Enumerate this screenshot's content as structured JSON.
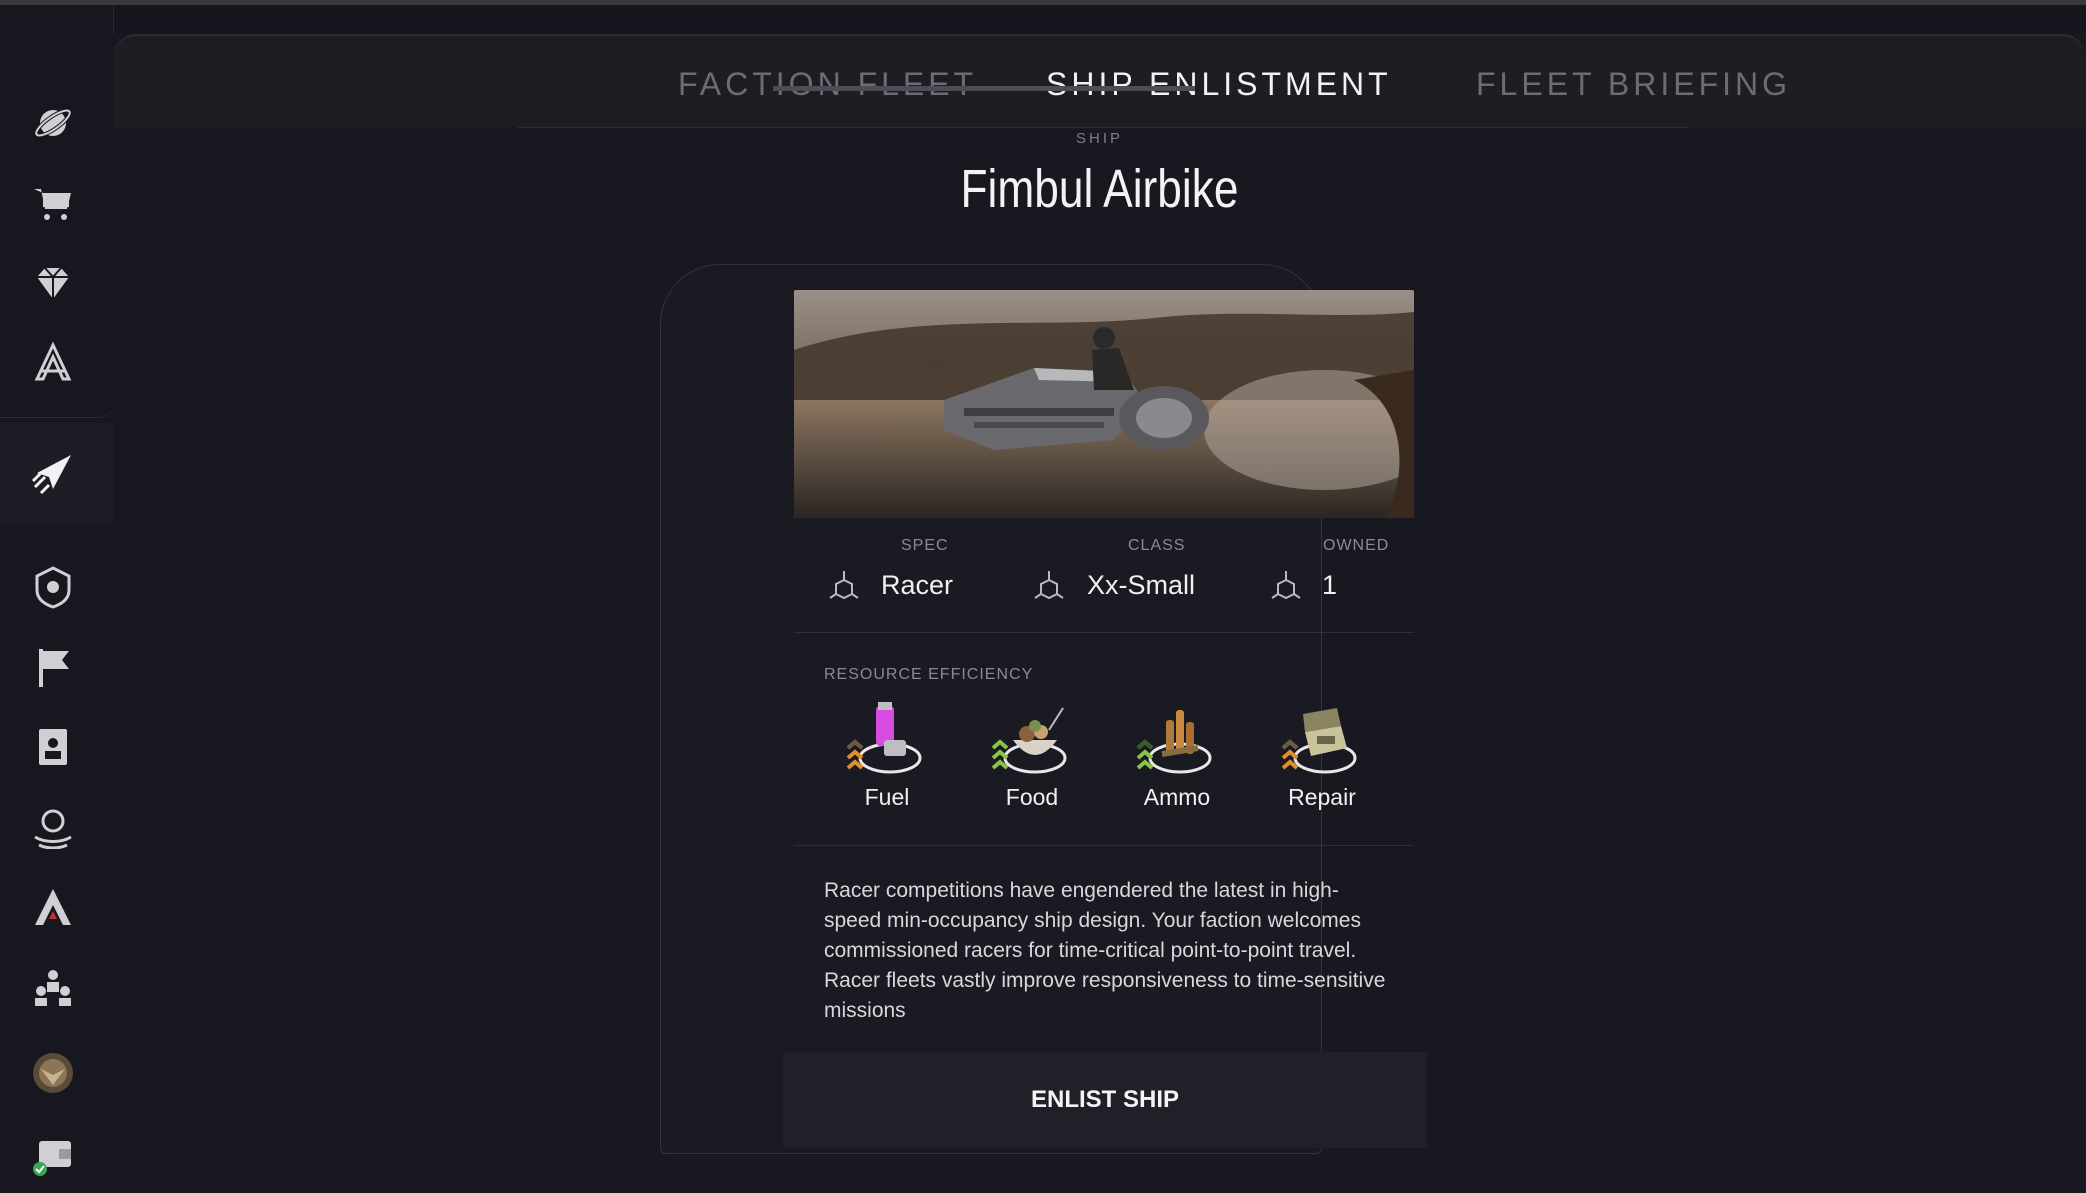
{
  "tabs": [
    {
      "label": "FACTION FLEET"
    },
    {
      "label": "SHIP ENLISTMENT"
    },
    {
      "label": "FLEET BRIEFING"
    }
  ],
  "active_tab": "SHIP ENLISTMENT",
  "ship": {
    "caption": "SHIP",
    "name": "Fimbul Airbike"
  },
  "stats": {
    "spec": {
      "label": "SPEC",
      "value": "Racer"
    },
    "class": {
      "label": "CLASS",
      "value": "Xx-Small"
    },
    "owned": {
      "label": "OWNED",
      "value": "1"
    }
  },
  "resources": {
    "title": "RESOURCE EFFICIENCY",
    "items": [
      {
        "label": "Fuel",
        "icon": "fuel-canister-icon"
      },
      {
        "label": "Food",
        "icon": "food-bowl-icon"
      },
      {
        "label": "Ammo",
        "icon": "ammo-rounds-icon"
      },
      {
        "label": "Repair",
        "icon": "repair-kit-icon"
      }
    ]
  },
  "description": "Racer competitions have engendered the latest in high-speed min-occupancy ship design. Your faction welcomes commissioned racers for time-critical point-to-point travel. Racer fleets vastly improve responsiveness to time-sensitive missions",
  "enlist_button": "ENLIST SHIP",
  "sidebar": {
    "icons": [
      "planet-icon",
      "cart-icon",
      "diamond-icon",
      "faction-emblem-icon",
      "fleet-ship-icon",
      "badge-icon",
      "flag-icon",
      "contract-icon",
      "guild-icon",
      "faction-logo-icon",
      "crew-icon",
      "avatar-icon",
      "wallet-icon"
    ],
    "active": "fleet-ship-icon"
  },
  "colors": {
    "background": "#16161e",
    "accent_green": "#8bc34a",
    "accent_orange": "#e0902a",
    "fuel_pink": "#d84be0",
    "wallet_check": "#3aa757"
  }
}
